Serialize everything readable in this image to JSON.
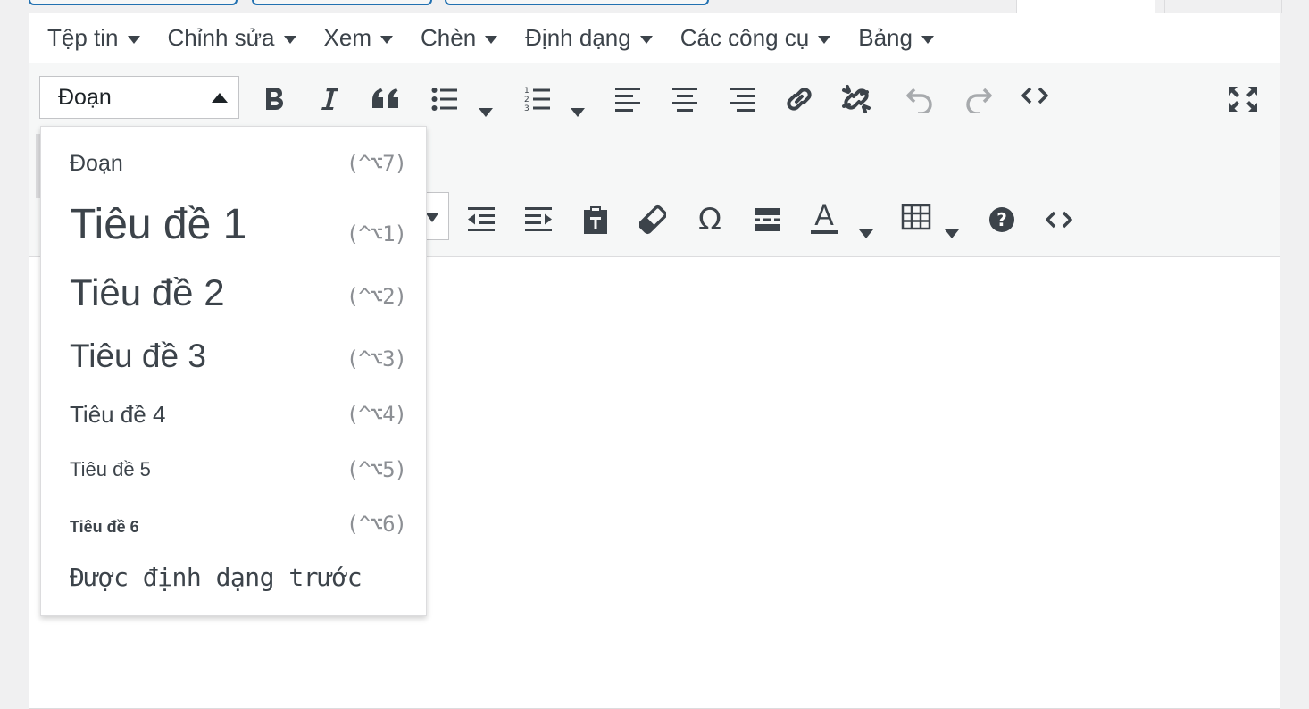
{
  "menubar": {
    "items": [
      {
        "label": "Tệp tin"
      },
      {
        "label": "Chỉnh sửa"
      },
      {
        "label": "Xem"
      },
      {
        "label": "Chèn"
      },
      {
        "label": "Định dạng"
      },
      {
        "label": "Các công cụ"
      },
      {
        "label": "Bảng"
      }
    ]
  },
  "toolbar": {
    "format_select_value": "Đoạn",
    "row1_icons": [
      "bold-icon",
      "italic-icon",
      "blockquote-icon",
      "bullet-list-icon",
      "numbered-list-icon",
      "align-left-icon",
      "align-center-icon",
      "align-right-icon",
      "link-icon",
      "unlink-icon",
      "undo-icon",
      "redo-icon",
      "code-icon",
      "fullscreen-icon"
    ],
    "row2_icons": [
      "outdent-icon",
      "indent-icon",
      "paste-text-icon",
      "clear-formatting-icon",
      "special-character-icon",
      "read-more-icon",
      "text-color-icon",
      "table-icon",
      "help-icon",
      "code-icon"
    ],
    "text_color_letter": "A"
  },
  "format_dropdown": {
    "items": [
      {
        "label": "Đoạn",
        "shortcut": "(^⌥7)"
      },
      {
        "label": "Tiêu đề 1",
        "shortcut": "(^⌥1)"
      },
      {
        "label": "Tiêu đề 2",
        "shortcut": "(^⌥2)"
      },
      {
        "label": "Tiêu đề 3",
        "shortcut": "(^⌥3)"
      },
      {
        "label": "Tiêu đề 4",
        "shortcut": "(^⌥4)"
      },
      {
        "label": "Tiêu đề 5",
        "shortcut": "(^⌥5)"
      },
      {
        "label": "Tiêu đề 6",
        "shortcut": "(^⌥6)"
      },
      {
        "label": "Được định dạng trước",
        "shortcut": ""
      }
    ]
  },
  "colors": {
    "icon": "#3c434a",
    "disabled_icon": "#a7aaad",
    "toolbar_bg": "#f6f7f7",
    "tab_border": "#2271b1"
  }
}
